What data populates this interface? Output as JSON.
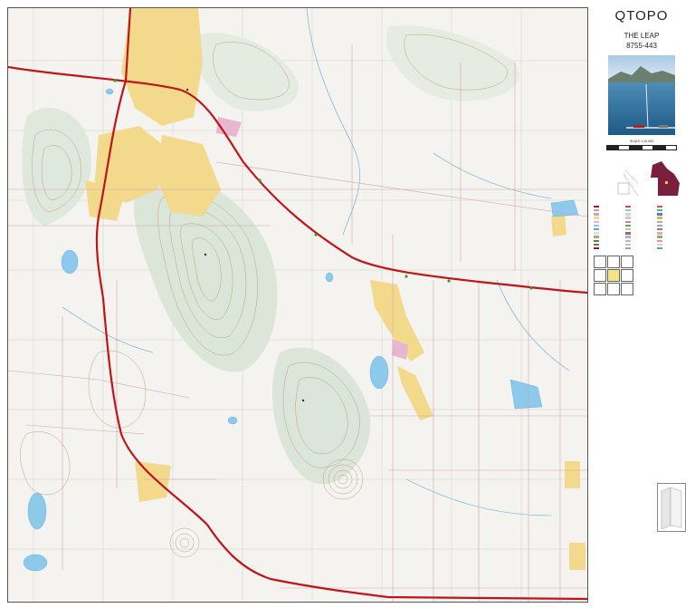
{
  "header": {
    "brand": "QTOPO",
    "sheet_name": "THE LEAP",
    "sheet_number": "8755-443"
  },
  "scale": {
    "label": "SCALE 1:10,000"
  },
  "colors": {
    "highway": "#c0141a",
    "urban": "#f2d98b",
    "water": "#8cc9ea",
    "contour": "#b9a184",
    "vegetation": "#cfe5cf",
    "inset_queensland": "#7a1f3d",
    "frame": "#555555"
  },
  "icons": {
    "photo": "aerial-coastline-photo",
    "inset": "queensland-locator-map",
    "fold": "map-fold-diagram"
  }
}
